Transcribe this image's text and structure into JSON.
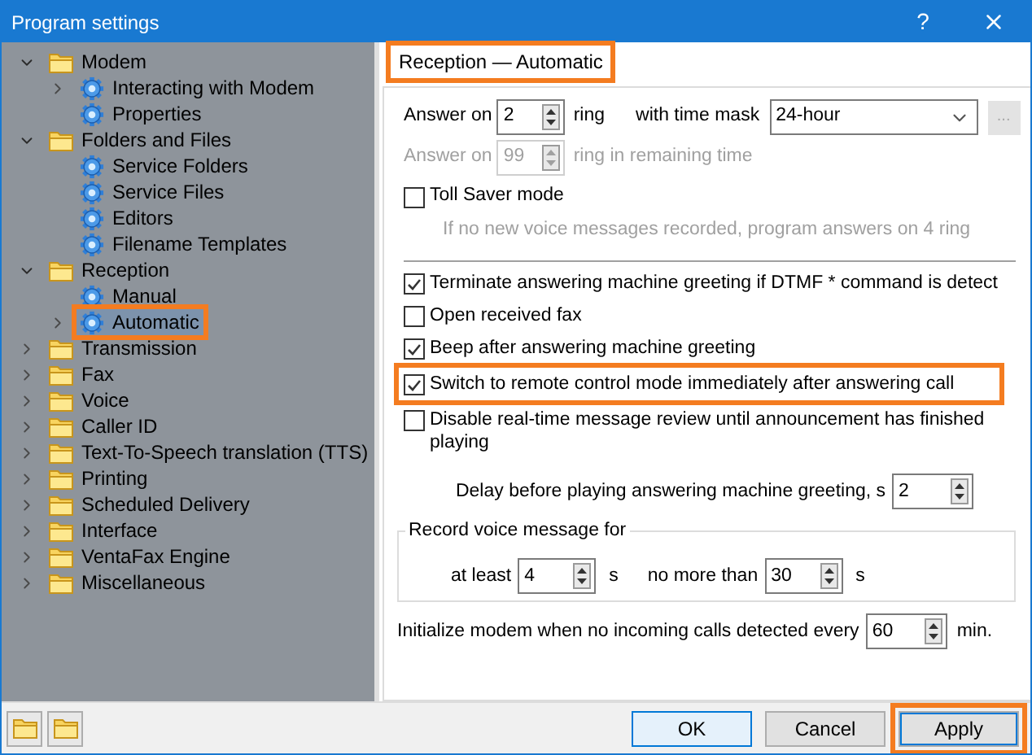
{
  "window": {
    "title": "Program settings",
    "help": "?"
  },
  "tree": [
    {
      "label": "Modem",
      "kind": "folder",
      "expanded": true,
      "selected": false,
      "highlighted": false,
      "children": [
        {
          "label": "Interacting with Modem",
          "kind": "gear",
          "expanded": false,
          "selected": false,
          "highlighted": false
        },
        {
          "label": "Properties",
          "kind": "gear",
          "selected": false,
          "highlighted": false
        }
      ]
    },
    {
      "label": "Folders and Files",
      "kind": "folder",
      "expanded": true,
      "selected": false,
      "highlighted": false,
      "children": [
        {
          "label": "Service Folders",
          "kind": "gear",
          "selected": false,
          "highlighted": false
        },
        {
          "label": "Service Files",
          "kind": "gear",
          "selected": false,
          "highlighted": false
        },
        {
          "label": "Editors",
          "kind": "gear",
          "selected": false,
          "highlighted": false
        },
        {
          "label": "Filename Templates",
          "kind": "gear",
          "selected": false,
          "highlighted": false
        }
      ]
    },
    {
      "label": "Reception",
      "kind": "folder",
      "expanded": true,
      "selected": false,
      "highlighted": false,
      "children": [
        {
          "label": "Manual",
          "kind": "gear",
          "selected": false,
          "highlighted": false
        },
        {
          "label": "Automatic",
          "kind": "gear",
          "expanded": false,
          "selected": true,
          "highlighted": true
        }
      ]
    },
    {
      "label": "Transmission",
      "kind": "folder",
      "expanded": false,
      "selected": false,
      "highlighted": false
    },
    {
      "label": "Fax",
      "kind": "folder",
      "expanded": false,
      "selected": false,
      "highlighted": false
    },
    {
      "label": "Voice",
      "kind": "folder",
      "expanded": false,
      "selected": false,
      "highlighted": false
    },
    {
      "label": "Caller ID",
      "kind": "folder",
      "expanded": false,
      "selected": false,
      "highlighted": false
    },
    {
      "label": "Text-To-Speech translation (TTS)",
      "kind": "folder",
      "expanded": false,
      "selected": false,
      "highlighted": false
    },
    {
      "label": "Printing",
      "kind": "folder",
      "expanded": false,
      "selected": false,
      "highlighted": false
    },
    {
      "label": "Scheduled Delivery",
      "kind": "folder",
      "expanded": false,
      "selected": false,
      "highlighted": false
    },
    {
      "label": "Interface",
      "kind": "folder",
      "expanded": false,
      "selected": false,
      "highlighted": false
    },
    {
      "label": "VentaFax Engine",
      "kind": "folder",
      "expanded": false,
      "selected": false,
      "highlighted": false
    },
    {
      "label": "Miscellaneous",
      "kind": "folder",
      "expanded": false,
      "selected": false,
      "highlighted": false
    }
  ],
  "panel": {
    "title": "Reception — Automatic",
    "highlighted": true,
    "answer_on": {
      "label": "Answer on",
      "value": "2",
      "unit": "ring"
    },
    "time_mask": {
      "label": "with time mask",
      "value": "24-hour",
      "button": "...",
      "button_disabled": true
    },
    "remaining": {
      "label": "Answer on",
      "value": "99",
      "unit": "ring in remaining time",
      "disabled": true
    },
    "toll_saver": {
      "label": "Toll Saver mode",
      "checked": false
    },
    "toll_saver_hint": "If no new voice messages recorded, program answers on 4 ring",
    "options": [
      {
        "label": "Terminate answering machine greeting if DTMF * command is detect",
        "checked": true,
        "highlighted": false
      },
      {
        "label": "Open received fax",
        "checked": false,
        "highlighted": false
      },
      {
        "label": "Beep after answering machine greeting",
        "checked": true,
        "highlighted": false
      },
      {
        "label": "Switch to remote control mode immediately after answering call",
        "checked": true,
        "highlighted": true
      },
      {
        "label": "Disable real-time message review until announcement has finished playing",
        "checked": false,
        "highlighted": false
      }
    ],
    "delay": {
      "label": "Delay before playing answering machine greeting, s",
      "value": "2"
    },
    "record": {
      "title": "Record voice message for",
      "min_label": "at least",
      "min_value": "4",
      "min_unit": "s",
      "max_label": "no more than",
      "max_value": "30",
      "max_unit": "s"
    },
    "init": {
      "label": "Initialize modem when no incoming calls detected every",
      "value": "60",
      "unit": "min."
    }
  },
  "footer": {
    "buttons": [
      {
        "label": "OK",
        "kind": "default",
        "highlighted": false
      },
      {
        "label": "Cancel",
        "kind": "normal",
        "highlighted": false
      },
      {
        "label": "Apply",
        "kind": "normal",
        "highlighted": true
      }
    ]
  }
}
